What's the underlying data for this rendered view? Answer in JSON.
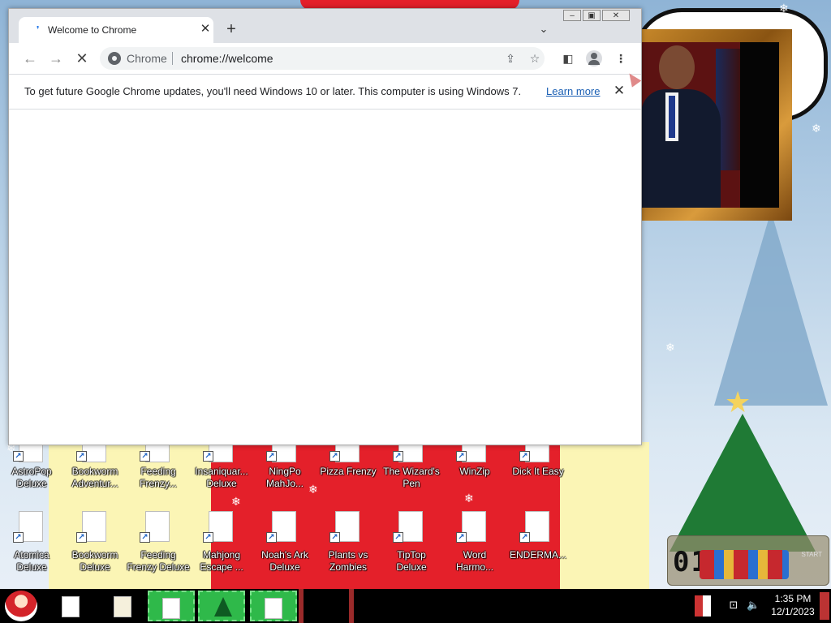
{
  "browser": {
    "tab": {
      "title": "Welcome to Chrome",
      "close_icon": "close-icon"
    },
    "new_tab_label": "+",
    "window_buttons": [
      "minimize",
      "restore",
      "close"
    ],
    "address_bar": {
      "chip": "Chrome",
      "url": "chrome://welcome"
    },
    "infobar": {
      "message": "To get future Google Chrome updates, you'll need Windows 10 or later. This computer is using Windows 7.",
      "link": "Learn more"
    }
  },
  "desktop_icons": {
    "row1": [
      {
        "line1": "AstroPop",
        "line2": "Deluxe"
      },
      {
        "line1": "Bookworm",
        "line2": "Adventur..."
      },
      {
        "line1": "Feeding",
        "line2": "Frenzy..."
      },
      {
        "line1": "Insaniquar...",
        "line2": "Deluxe"
      },
      {
        "line1": "NingPo",
        "line2": "MahJo..."
      },
      {
        "line1": "Pizza Frenzy",
        "line2": ""
      },
      {
        "line1": "The Wizard's",
        "line2": "Pen"
      },
      {
        "line1": "WinZip",
        "line2": ""
      },
      {
        "line1": "Dick It Easy",
        "line2": ""
      }
    ],
    "row2": [
      {
        "line1": "Atomica",
        "line2": "Deluxe"
      },
      {
        "line1": "Bookworm",
        "line2": "Deluxe"
      },
      {
        "line1": "Feeding",
        "line2": "Frenzy Deluxe"
      },
      {
        "line1": "Mahjong",
        "line2": "Escape ..."
      },
      {
        "line1": "Noah's Ark",
        "line2": "Deluxe"
      },
      {
        "line1": "Plants vs",
        "line2": "Zombies"
      },
      {
        "line1": "TipTop",
        "line2": "Deluxe"
      },
      {
        "line1": "Word",
        "line2": "Harmo..."
      },
      {
        "line1": "ENDERMA...",
        "line2": ""
      }
    ]
  },
  "widget_clock": {
    "digits": "01:30",
    "start": "START"
  },
  "taskbar": {
    "time": "1:35 PM",
    "date": "12/1/2023"
  }
}
